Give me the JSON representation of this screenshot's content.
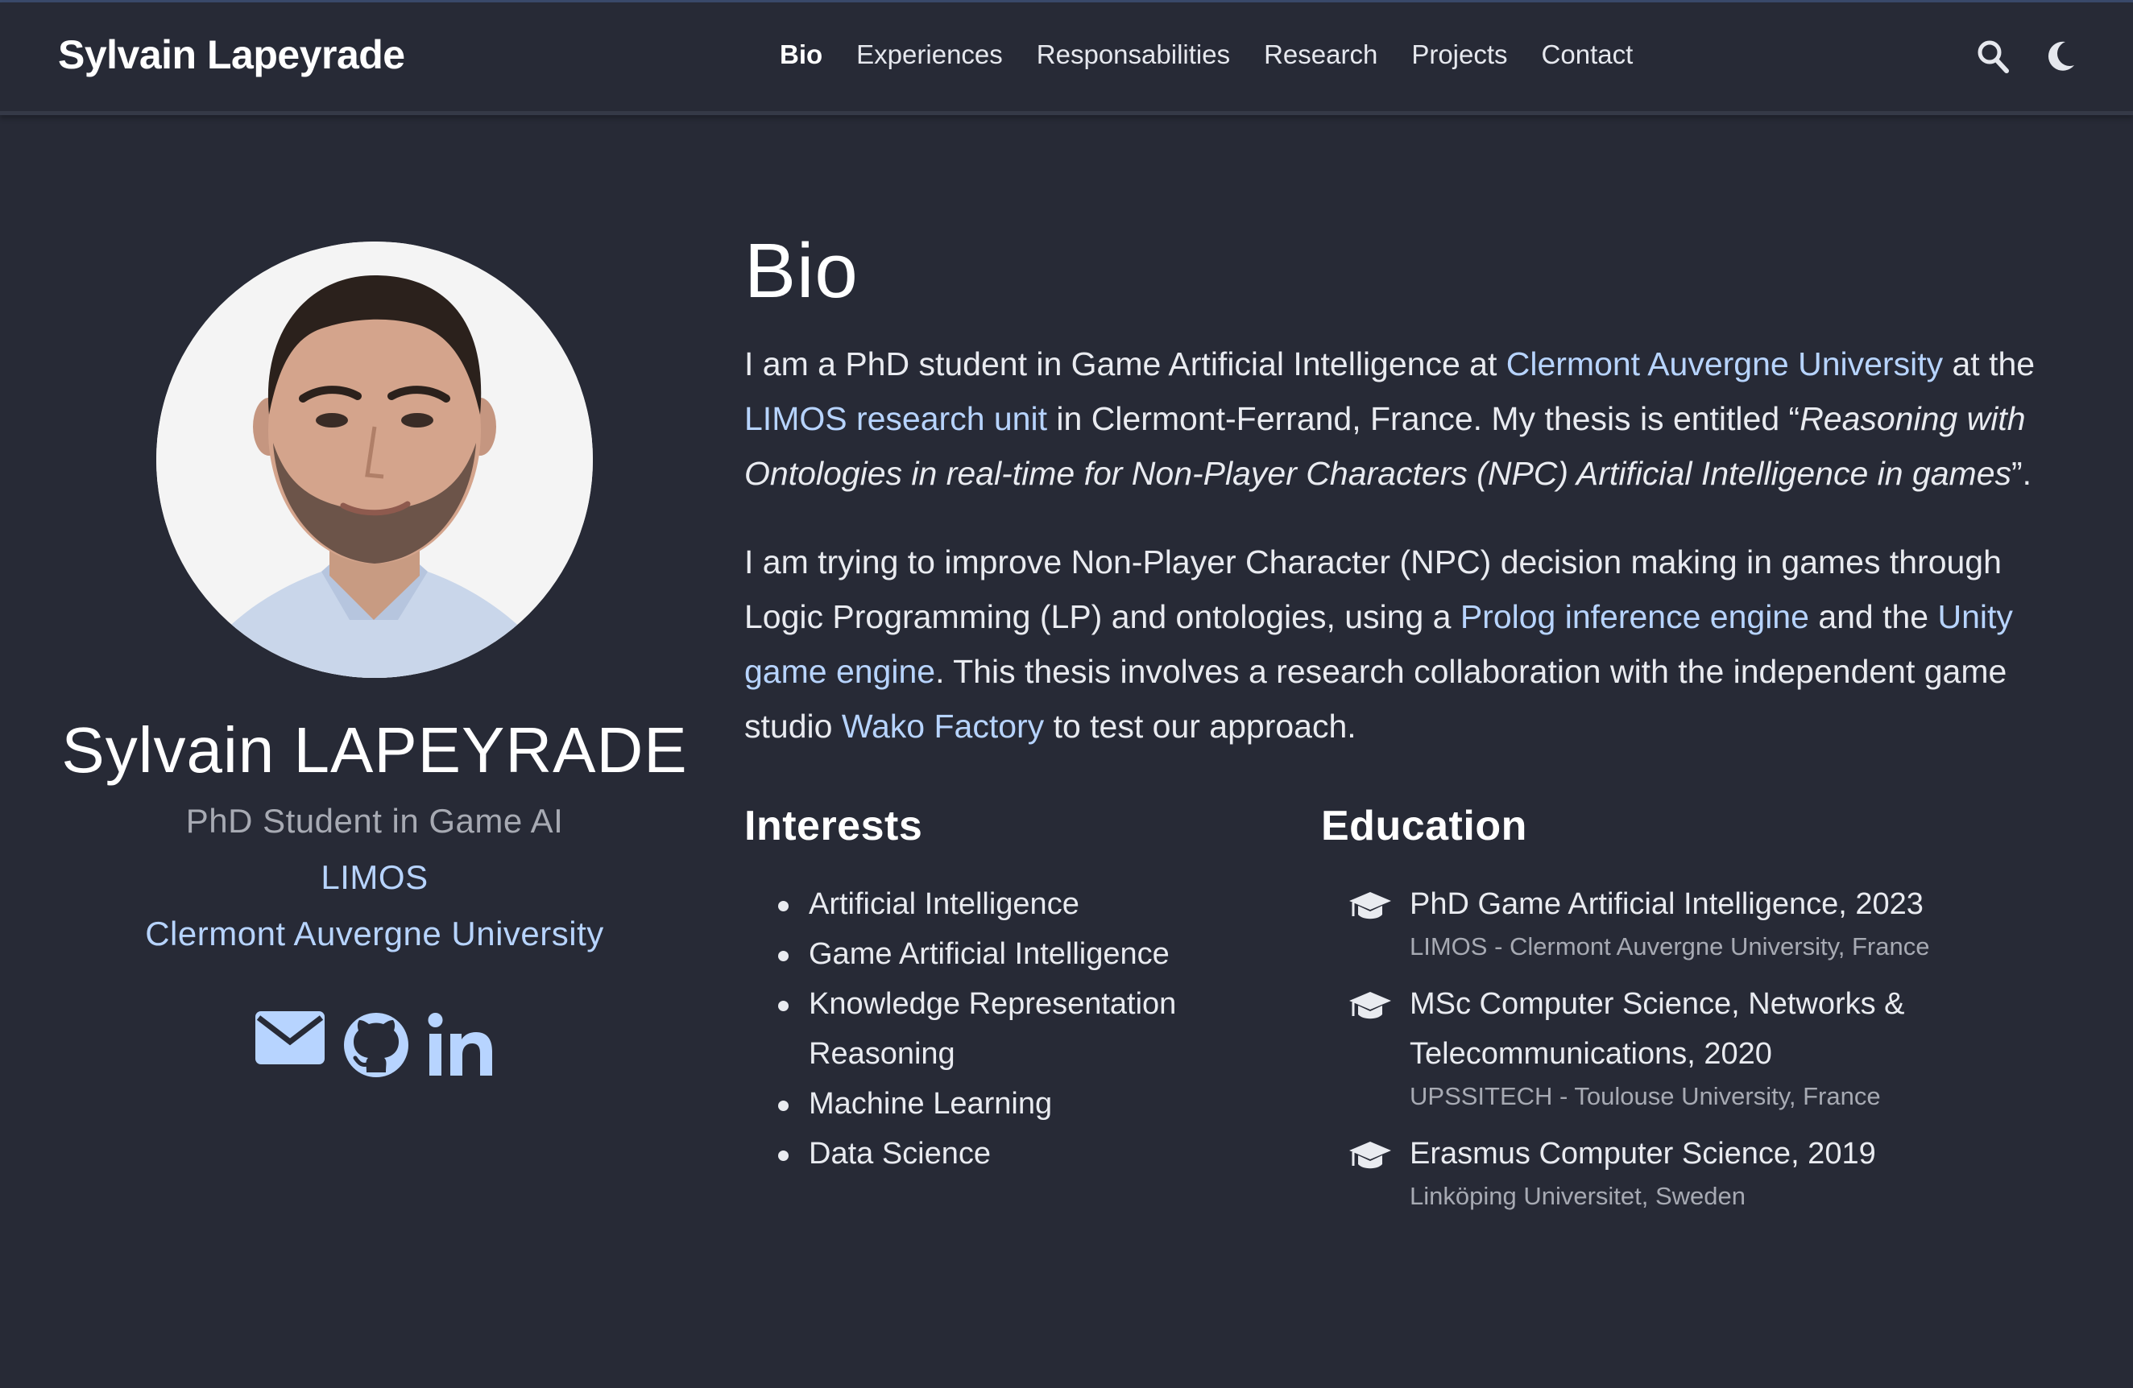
{
  "navbar": {
    "brand": "Sylvain Lapeyrade",
    "links": [
      "Bio",
      "Experiences",
      "Responsabilities",
      "Research",
      "Projects",
      "Contact"
    ],
    "active": "Bio",
    "icons": [
      "search-icon",
      "moon-icon"
    ]
  },
  "profile": {
    "name": "Sylvain LAPEYRADE",
    "role": "PhD Student in Game AI",
    "org": "LIMOS",
    "university": "Clermont Auvergne University",
    "socials": [
      "envelope-icon",
      "github-icon",
      "linkedin-icon"
    ]
  },
  "bio": {
    "title": "Bio",
    "p1": {
      "t1": "I am a PhD student in Game Artificial Intelligence at ",
      "l1": "Clermont Auvergne University",
      "t2": " at the ",
      "l2": "LIMOS research unit",
      "t3": " in Clermont-Ferrand, France. My thesis is entitled “",
      "em": "Reasoning with Ontologies in real-time for Non-Player Characters (NPC) Artificial Intelligence in games",
      "t4": "”."
    },
    "p2": {
      "t1": "I am trying to improve Non-Player Character (NPC) decision making in games through Logic Programming (LP) and ontologies, using a ",
      "l1": "Prolog inference engine",
      "t2": " and the ",
      "l2": "Unity game engine",
      "t3": ". This thesis involves a research collaboration with the independent game studio ",
      "l3": "Wako Factory",
      "t4": " to test our approach."
    }
  },
  "interests": {
    "title": "Interests",
    "items": [
      "Artificial Intelligence",
      "Game Artificial Intelligence",
      "Knowledge Representation Reasoning",
      "Machine Learning",
      "Data Science"
    ]
  },
  "education": {
    "title": "Education",
    "items": [
      {
        "course": "PhD Game Artificial Intelligence, 2023",
        "institution": "LIMOS - Clermont Auvergne University, France"
      },
      {
        "course": "MSc Computer Science, Networks & Telecommunications, 2020",
        "institution": "UPSSITECH - Toulouse University, France"
      },
      {
        "course": "Erasmus Computer Science, 2019",
        "institution": "Linköping Universitet, Sweden"
      }
    ]
  },
  "colors": {
    "background": "#272a36",
    "link": "#b7d4ff",
    "muted": "#a7aab3",
    "text": "#e9ebf0"
  }
}
